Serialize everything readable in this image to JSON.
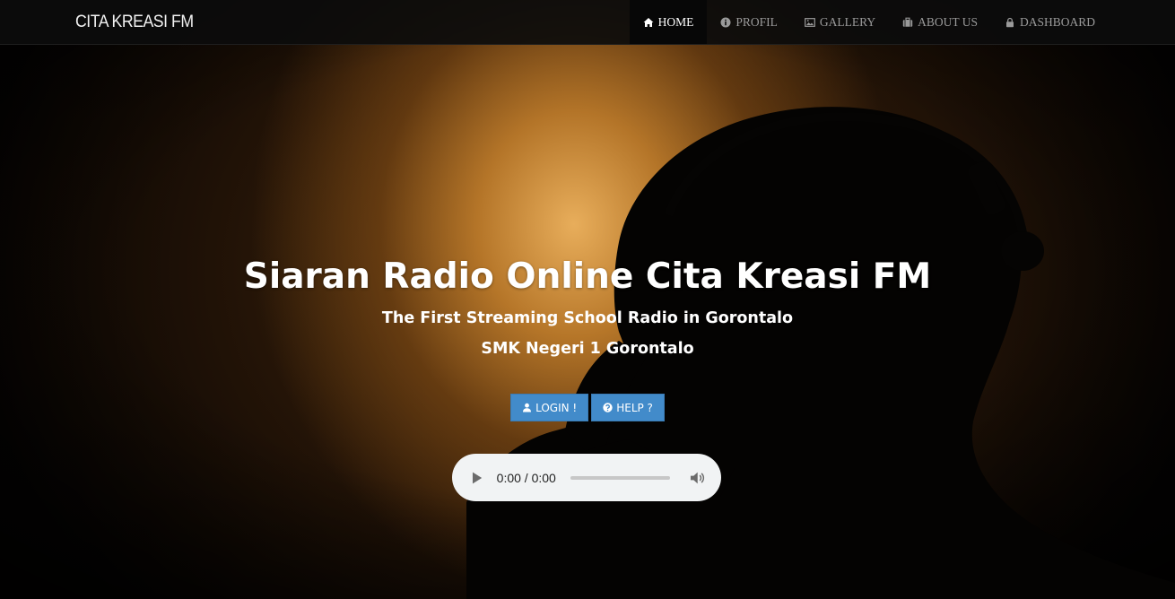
{
  "navbar": {
    "brand": "CITA KREASI FM",
    "items": [
      {
        "label": "HOME",
        "icon": "home-icon",
        "active": true
      },
      {
        "label": "PROFIL",
        "icon": "info-icon",
        "active": false
      },
      {
        "label": "GALLERY",
        "icon": "picture-icon",
        "active": false
      },
      {
        "label": "ABOUT US",
        "icon": "briefcase-icon",
        "active": false
      },
      {
        "label": "DASHBOARD",
        "icon": "lock-icon",
        "active": false
      }
    ]
  },
  "hero": {
    "title": "Siaran Radio Online Cita Kreasi FM",
    "subtitle1": "The First Streaming School Radio in Gorontalo",
    "subtitle2": "SMK Negeri 1 Gorontalo",
    "buttons": {
      "login": {
        "label": "LOGIN !",
        "icon": "user-icon"
      },
      "help": {
        "label": "HELP ?",
        "icon": "question-circle-icon"
      }
    }
  },
  "player": {
    "time": "0:00 / 0:00",
    "progress": 0
  },
  "colors": {
    "navbar_bg": "#0c0c0c",
    "accent_button": "#428bca",
    "player_bg": "#f1f3f4"
  }
}
